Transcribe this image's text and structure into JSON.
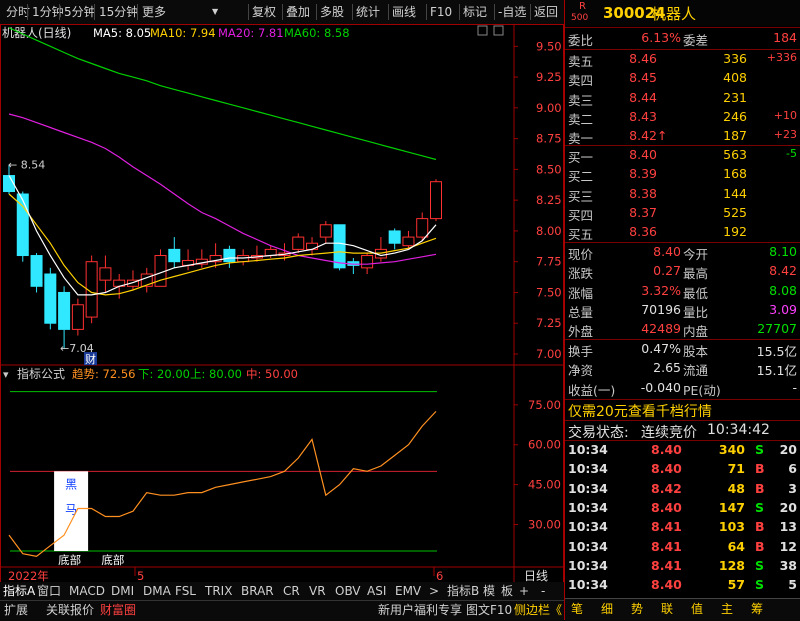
{
  "toolbar": {
    "left": [
      "分时",
      "1分钟",
      "5分钟",
      "15分钟",
      "更多"
    ],
    "right": [
      "复权",
      "叠加",
      "多股",
      "统计",
      "画线",
      "F10",
      "标记",
      "-自选",
      "返回"
    ]
  },
  "main_title": "机器人(日线)",
  "ma": [
    {
      "label": "MA5: 8.05",
      "color": "#ffffff"
    },
    {
      "label": "MA10: 7.94",
      "color": "#ffd000"
    },
    {
      "label": "MA20: 7.81",
      "color": "#e020e0"
    },
    {
      "label": "MA60: 8.58",
      "color": "#00d000"
    }
  ],
  "price_axis": [
    "9.50",
    "9.25",
    "9.00",
    "8.75",
    "8.50",
    "8.25",
    "8.00",
    "7.75",
    "7.50",
    "7.25",
    "7.00"
  ],
  "price_annotations": {
    "high": "8.54",
    "low": "7.04",
    "cai": "财"
  },
  "indicator": {
    "name": "指标公式",
    "trend": "趋势: 72.56",
    "lower": "下: 20.00",
    "upper": "上: 80.00",
    "mid": "中: 50.00",
    "axis": [
      "75.00",
      "60.00",
      "45.00",
      "30.00"
    ],
    "box_top": "黑",
    "box_bottom": "马",
    "bottom1": "底部",
    "bottom2": "底部"
  },
  "date_axis": {
    "year": "2022年",
    "m5": "5",
    "m6": "6"
  },
  "bottom_axis_label": "日线",
  "tabs1": [
    "指标A",
    "窗口",
    "MACD",
    "DMI",
    "DMA",
    "FSL",
    "TRIX",
    "BRAR",
    "CR",
    "VR",
    "OBV",
    "ASI",
    "EMV",
    ">",
    "指标B",
    "模",
    "板",
    "+",
    "-"
  ],
  "tabs2": [
    "扩展",
    "关联报价",
    "财富圈"
  ],
  "tabs2_right": [
    "新用户福利专享",
    "图文F10",
    "侧边栏《"
  ],
  "panel_tabs": [
    "笔",
    "细",
    "势",
    "联",
    "值",
    "主",
    "筹"
  ],
  "stock": {
    "code": "300024",
    "name": "机器人",
    "badge": "R",
    "badge_sub": "500"
  },
  "weibi": {
    "l1": "委比",
    "v1": "6.13%",
    "l2": "委差",
    "v2": "184"
  },
  "sell": [
    {
      "label": "卖五",
      "price": "8.46",
      "vol": "336",
      "chg": "+336"
    },
    {
      "label": "卖四",
      "price": "8.45",
      "vol": "408",
      "chg": ""
    },
    {
      "label": "卖三",
      "price": "8.44",
      "vol": "231",
      "chg": ""
    },
    {
      "label": "卖二",
      "price": "8.43",
      "vol": "246",
      "chg": "+10"
    },
    {
      "label": "卖一",
      "price": "8.42",
      "vol": "187",
      "chg": "+23",
      "arrow": "↑"
    }
  ],
  "buy": [
    {
      "label": "买一",
      "price": "8.40",
      "vol": "563",
      "chg": "-5"
    },
    {
      "label": "买二",
      "price": "8.39",
      "vol": "168",
      "chg": ""
    },
    {
      "label": "买三",
      "price": "8.38",
      "vol": "144",
      "chg": ""
    },
    {
      "label": "买四",
      "price": "8.37",
      "vol": "525",
      "chg": ""
    },
    {
      "label": "买五",
      "price": "8.36",
      "vol": "192",
      "chg": ""
    }
  ],
  "quote": [
    {
      "l1": "现价",
      "v1": "8.40",
      "c1": "red",
      "l2": "今开",
      "v2": "8.10",
      "c2": "grn"
    },
    {
      "l1": "涨跌",
      "v1": "0.27",
      "c1": "red",
      "l2": "最高",
      "v2": "8.42",
      "c2": "red"
    },
    {
      "l1": "涨幅",
      "v1": "3.32%",
      "c1": "red",
      "l2": "最低",
      "v2": "8.08",
      "c2": "grn"
    },
    {
      "l1": "总量",
      "v1": "70196",
      "c1": "wht",
      "l2": "量比",
      "v2": "3.09",
      "c2": "mag"
    },
    {
      "l1": "外盘",
      "v1": "42489",
      "c1": "red",
      "l2": "内盘",
      "v2": "27707",
      "c2": "grn"
    }
  ],
  "fund": [
    {
      "l1": "换手",
      "v1": "0.47%",
      "l2": "股本",
      "v2": "15.5亿"
    },
    {
      "l1": "净资",
      "v1": "2.65",
      "l2": "流通",
      "v2": "15.1亿"
    },
    {
      "l1": "收益(一)",
      "v1": "-0.040",
      "l2": "PE(动)",
      "v2": "-"
    }
  ],
  "promo": "仅需20元查看千档行情",
  "trade_status": {
    "label": "交易状态:",
    "status": "连续竞价",
    "time": "10:34:42"
  },
  "ticks": [
    {
      "t": "10:34",
      "p": "8.40",
      "v": "340",
      "s": "S",
      "n": "20"
    },
    {
      "t": "10:34",
      "p": "8.40",
      "v": "71",
      "s": "B",
      "n": "6"
    },
    {
      "t": "10:34",
      "p": "8.42",
      "v": "48",
      "s": "B",
      "n": "3"
    },
    {
      "t": "10:34",
      "p": "8.40",
      "v": "147",
      "s": "S",
      "n": "20"
    },
    {
      "t": "10:34",
      "p": "8.41",
      "v": "103",
      "s": "B",
      "n": "13"
    },
    {
      "t": "10:34",
      "p": "8.41",
      "v": "64",
      "s": "B",
      "n": "12"
    },
    {
      "t": "10:34",
      "p": "8.41",
      "v": "128",
      "s": "S",
      "n": "38"
    },
    {
      "t": "10:34",
      "p": "8.40",
      "v": "57",
      "s": "S",
      "n": "5"
    }
  ],
  "chart_data": [
    {
      "type": "candlestick",
      "title": "机器人(日线)",
      "ylim": [
        7.0,
        9.6
      ],
      "candles": [
        {
          "o": 8.45,
          "c": 8.32,
          "h": 8.54,
          "l": 8.3
        },
        {
          "o": 8.3,
          "c": 7.8,
          "h": 8.32,
          "l": 7.75
        },
        {
          "o": 7.8,
          "c": 7.55,
          "h": 7.82,
          "l": 7.5
        },
        {
          "o": 7.65,
          "c": 7.25,
          "h": 7.7,
          "l": 7.2
        },
        {
          "o": 7.5,
          "c": 7.2,
          "h": 7.55,
          "l": 7.04
        },
        {
          "o": 7.2,
          "c": 7.4,
          "h": 7.45,
          "l": 7.15
        },
        {
          "o": 7.3,
          "c": 7.75,
          "h": 7.8,
          "l": 7.25
        },
        {
          "o": 7.6,
          "c": 7.7,
          "h": 7.8,
          "l": 7.5
        },
        {
          "o": 7.55,
          "c": 7.6,
          "h": 7.65,
          "l": 7.45
        },
        {
          "o": 7.55,
          "c": 7.6,
          "h": 7.68,
          "l": 7.52
        },
        {
          "o": 7.55,
          "c": 7.65,
          "h": 7.7,
          "l": 7.5
        },
        {
          "o": 7.55,
          "c": 7.8,
          "h": 7.85,
          "l": 7.55
        },
        {
          "o": 7.85,
          "c": 7.75,
          "h": 7.95,
          "l": 7.7
        },
        {
          "o": 7.72,
          "c": 7.76,
          "h": 7.85,
          "l": 7.68
        },
        {
          "o": 7.73,
          "c": 7.77,
          "h": 7.85,
          "l": 7.7
        },
        {
          "o": 7.75,
          "c": 7.8,
          "h": 7.9,
          "l": 7.7
        },
        {
          "o": 7.85,
          "c": 7.75,
          "h": 7.88,
          "l": 7.7
        },
        {
          "o": 7.75,
          "c": 7.8,
          "h": 7.85,
          "l": 7.72
        },
        {
          "o": 7.78,
          "c": 7.8,
          "h": 7.88,
          "l": 7.75
        },
        {
          "o": 7.8,
          "c": 7.85,
          "h": 7.88,
          "l": 7.78
        },
        {
          "o": 7.8,
          "c": 7.82,
          "h": 7.9,
          "l": 7.76
        },
        {
          "o": 7.85,
          "c": 7.95,
          "h": 7.98,
          "l": 7.82
        },
        {
          "o": 7.85,
          "c": 7.9,
          "h": 7.95,
          "l": 7.8
        },
        {
          "o": 7.95,
          "c": 8.05,
          "h": 8.08,
          "l": 7.9
        },
        {
          "o": 8.05,
          "c": 7.7,
          "h": 8.05,
          "l": 7.68
        },
        {
          "o": 7.75,
          "c": 7.72,
          "h": 7.78,
          "l": 7.65
        },
        {
          "o": 7.7,
          "c": 7.8,
          "h": 7.82,
          "l": 7.65
        },
        {
          "o": 7.78,
          "c": 7.85,
          "h": 7.95,
          "l": 7.75
        },
        {
          "o": 8.0,
          "c": 7.9,
          "h": 8.02,
          "l": 7.85
        },
        {
          "o": 7.88,
          "c": 7.95,
          "h": 8.0,
          "l": 7.85
        },
        {
          "o": 7.95,
          "c": 8.1,
          "h": 8.15,
          "l": 7.92
        },
        {
          "o": 8.1,
          "c": 8.4,
          "h": 8.42,
          "l": 8.08
        }
      ],
      "ma5": [
        8.45,
        8.25,
        8.0,
        7.8,
        7.62,
        7.48,
        7.48,
        7.5,
        7.55,
        7.58,
        7.62,
        7.66,
        7.7,
        7.72,
        7.74,
        7.76,
        7.78,
        7.78,
        7.79,
        7.8,
        7.81,
        7.83,
        7.85,
        7.9,
        7.9,
        7.88,
        7.84,
        7.8,
        7.82,
        7.85,
        7.92,
        8.05
      ],
      "ma10": [
        8.3,
        8.2,
        8.05,
        7.9,
        7.72,
        7.58,
        7.5,
        7.48,
        7.49,
        7.52,
        7.56,
        7.6,
        7.63,
        7.66,
        7.69,
        7.72,
        7.74,
        7.75,
        7.76,
        7.77,
        7.78,
        7.8,
        7.81,
        7.82,
        7.83,
        7.82,
        7.82,
        7.82,
        7.84,
        7.86,
        7.9,
        7.94
      ],
      "ma20": [
        8.95,
        8.92,
        8.88,
        8.84,
        8.8,
        8.76,
        8.72,
        8.67,
        8.6,
        8.52,
        8.45,
        8.38,
        8.3,
        8.22,
        8.15,
        8.1,
        8.04,
        7.98,
        7.93,
        7.88,
        7.84,
        7.8,
        7.78,
        7.76,
        7.74,
        7.73,
        7.73,
        7.74,
        7.75,
        7.77,
        7.79,
        7.81
      ],
      "ma60": [
        9.65,
        9.6,
        9.55,
        9.5,
        9.45,
        9.4,
        9.36,
        9.32,
        9.28,
        9.25,
        9.22,
        9.18,
        9.15,
        9.12,
        9.09,
        9.06,
        9.03,
        9.0,
        8.97,
        8.94,
        8.91,
        8.88,
        8.85,
        8.82,
        8.79,
        8.76,
        8.73,
        8.7,
        8.67,
        8.64,
        8.61,
        8.58
      ]
    },
    {
      "type": "line",
      "title": "指标公式",
      "ylim": [
        14,
        90
      ],
      "trend": [
        26,
        19,
        18,
        22,
        26,
        36,
        36,
        33,
        33,
        35,
        42,
        41,
        41,
        42,
        42,
        44,
        45,
        46,
        47,
        48,
        50,
        55,
        62,
        41,
        45,
        51,
        50,
        52,
        56,
        60,
        67,
        72.56
      ],
      "upper": 80,
      "mid": 50,
      "lower": 20
    }
  ]
}
